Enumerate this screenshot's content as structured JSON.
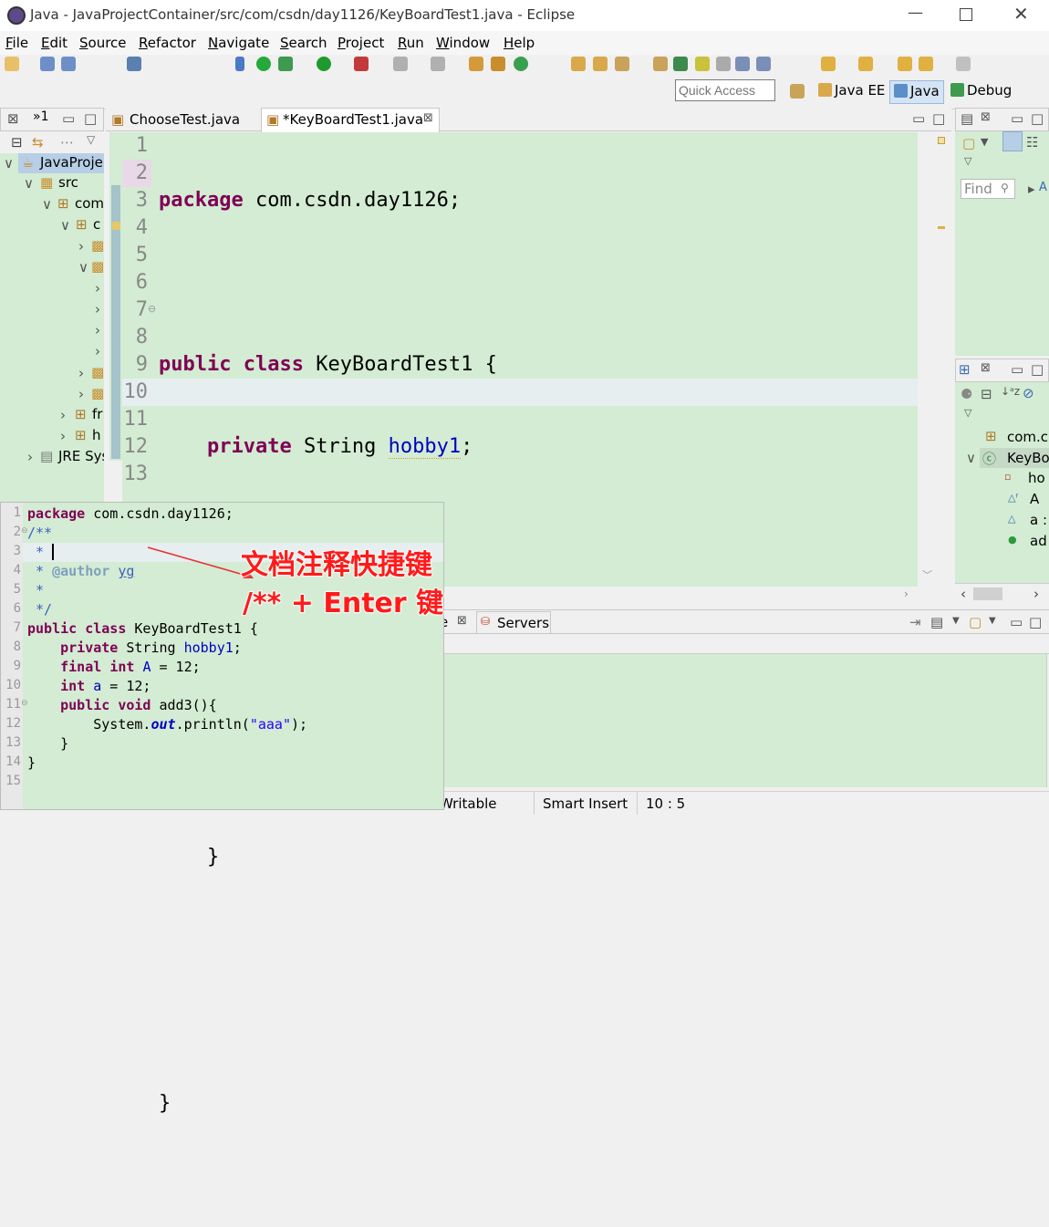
{
  "window": {
    "title": "Java - JavaProjectContainer/src/com/csdn/day1126/KeyBoardTest1.java - Eclipse"
  },
  "menu": [
    "File",
    "Edit",
    "Source",
    "Refactor",
    "Navigate",
    "Search",
    "Project",
    "Run",
    "Window",
    "Help"
  ],
  "quick_access": {
    "placeholder": "Quick Access"
  },
  "perspectives": [
    "Java EE",
    "Java",
    "Debug"
  ],
  "package_explorer": {
    "tab_label": "»1",
    "tree": [
      "JavaProje",
      "src",
      "com",
      "c",
      "JRE Sys",
      "fr",
      "h"
    ]
  },
  "editor": {
    "tabs": [
      "ChooseTest.java",
      "*KeyBoardTest1.java"
    ],
    "lines": [
      {
        "n": "1",
        "t": "package com.csdn.day1126;"
      },
      {
        "n": "2",
        "t": ""
      },
      {
        "n": "3",
        "t": "public class KeyBoardTest1 {"
      },
      {
        "n": "4",
        "t": "private String hobby1;"
      },
      {
        "n": "5",
        "t": "final int A = 12;"
      },
      {
        "n": "6",
        "t": "int a = 12;"
      },
      {
        "n": "7",
        "t": "public void add3(){"
      },
      {
        "n": "8",
        "t": "System.out.println(\"aaa\");"
      },
      {
        "n": "9",
        "t": "}"
      },
      {
        "n": "10",
        "t": ""
      },
      {
        "n": "11",
        "t": ""
      },
      {
        "n": "12",
        "t": "}"
      },
      {
        "n": "13",
        "t": ""
      }
    ]
  },
  "outline": {
    "find_placeholder": "Find",
    "items": [
      "com.c",
      "KeyBo",
      "ho",
      "A",
      "a :",
      "ad"
    ]
  },
  "bottom_panel": {
    "tabs": [
      "e",
      "Servers"
    ]
  },
  "status": {
    "writable": "Writable",
    "insert_mode": "Smart Insert",
    "position": "10 : 5"
  },
  "inset": {
    "lines": [
      "1",
      "2",
      "3",
      "4",
      "5",
      "6",
      "7",
      "8",
      "9",
      "10",
      "11",
      "12",
      "13",
      "14",
      "15"
    ],
    "annotation_line1": "文档注释快捷键",
    "annotation_line2": "/** + Enter 键"
  }
}
